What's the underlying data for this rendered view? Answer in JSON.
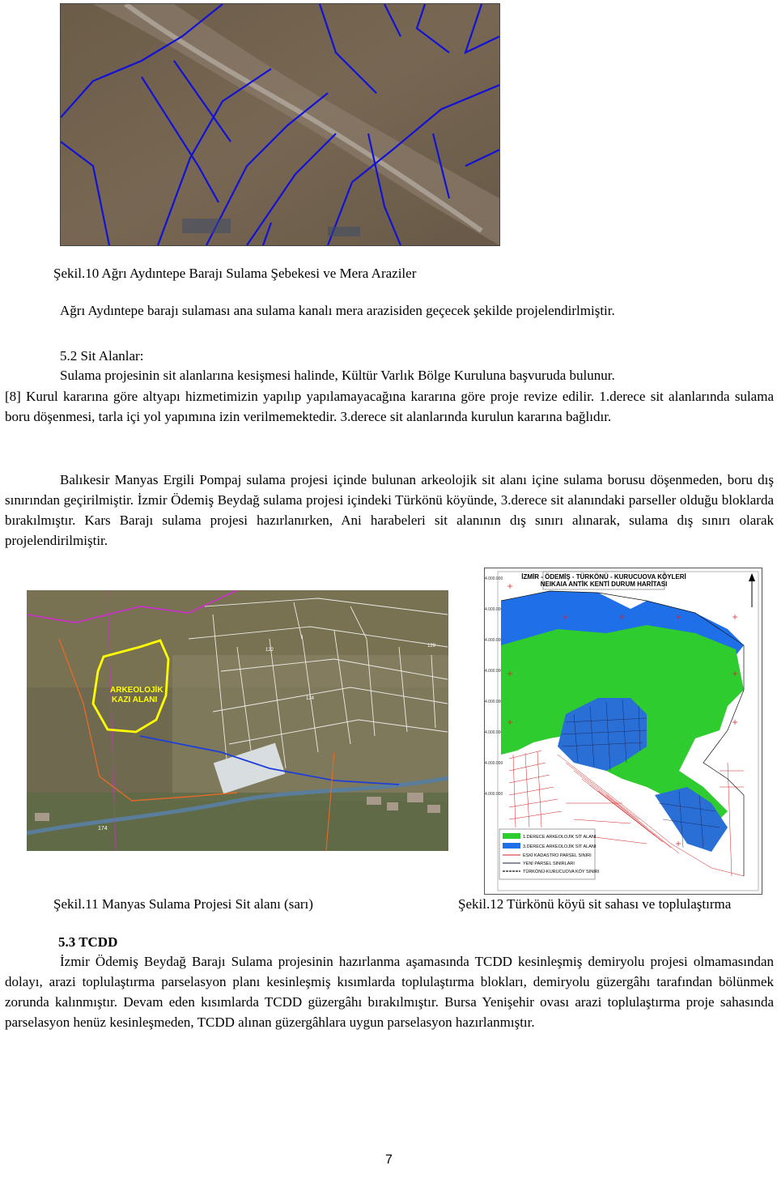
{
  "figure10": {
    "caption": "Şekil.10 Ağrı Aydıntepe Barajı Sulama Şebekesi ve Mera Araziler"
  },
  "paragraph1": "Ağrı Aydıntepe barajı sulaması ana sulama kanalı mera arazisiden geçecek şekilde projelendirlmiştir.",
  "section52": {
    "heading": "5.2 Sit Alanlar:",
    "line1": "Sulama projesinin sit alanlarına kesişmesi halinde, Kültür Varlık Bölge Kuruluna başvuruda bulunur.",
    "rest": "[8] Kurul kararına göre altyapı hizmetimizin yapılıp yapılamayacağına kararına göre proje revize edilir. 1.derece sit alanlarında sulama boru döşenmesi, tarla içi yol yapımına izin verilmemektedir. 3.derece sit alanlarında kurulun kararına bağlıdır.",
    "paragraph2": "Balıkesir Manyas Ergili Pompaj sulama projesi içinde bulunan arkeolojik sit alanı içine sulama borusu döşenmeden, boru dış sınırından geçirilmiştir. İzmir Ödemiş Beydağ sulama projesi içindeki Türkönü köyünde, 3.derece sit alanındaki parseller olduğu bloklarda bırakılmıştır. Kars Barajı sulama projesi hazırlanırken, Ani harabeleri sit alanının dış sınırı alınarak, sulama dış sınırı olarak projelendirilmiştir."
  },
  "figure11": {
    "caption": "Şekil.11 Manyas Sulama Projesi  Sit alanı (sarı)",
    "site_label_line1": "ARKEOLOJİK",
    "site_label_line2": "KAZI ALANI",
    "parcel_numbers": [
      "122",
      "124",
      "129",
      "174"
    ]
  },
  "figure12": {
    "caption": "Şekil.12 Türkönü köyü sit sahası ve toplulaştırma",
    "map_title_line1": "İZMİR - ÖDEMİŞ - TÜRKÖNÜ - KURUCUOVA  KÖYLERİ",
    "map_title_line2": "NEIKAIA ANTİK KENTİ DURUM HARİTASI",
    "legend": [
      "1.DERECE ARKEOLOJİK SİT ALANI",
      "3.DERECE ARKEOLOJİK SİT ALANI",
      "ESKİ KADASTRO PARSEL SINIRI",
      "YENİ PARSEL SINIRLARI",
      "TÜRKÖNÜ-KURUCUOVA KÖY SINIRI"
    ],
    "colors": {
      "first_degree": "#2ecc2e",
      "third_degree": "#1f6fe8"
    }
  },
  "section53": {
    "heading": "5.3 TCDD",
    "text": "İzmir Ödemiş Beydağ Barajı Sulama projesinin hazırlanma aşamasında TCDD kesinleşmiş demiryolu projesi olmamasından dolayı, arazi toplulaştırma parselasyon planı kesinleşmiş kısımlarda toplulaştırma blokları, demiryolu güzergâhı tarafından bölünmek zorunda kalınmıştır. Devam eden kısımlarda TCDD güzergâhı bırakılmıştır. Bursa Yenişehir ovası arazi toplulaştırma proje sahasında parselasyon henüz kesinleşmeden, TCDD alınan güzergâhlara uygun parselasyon hazırlanmıştır."
  },
  "page_number": "7"
}
